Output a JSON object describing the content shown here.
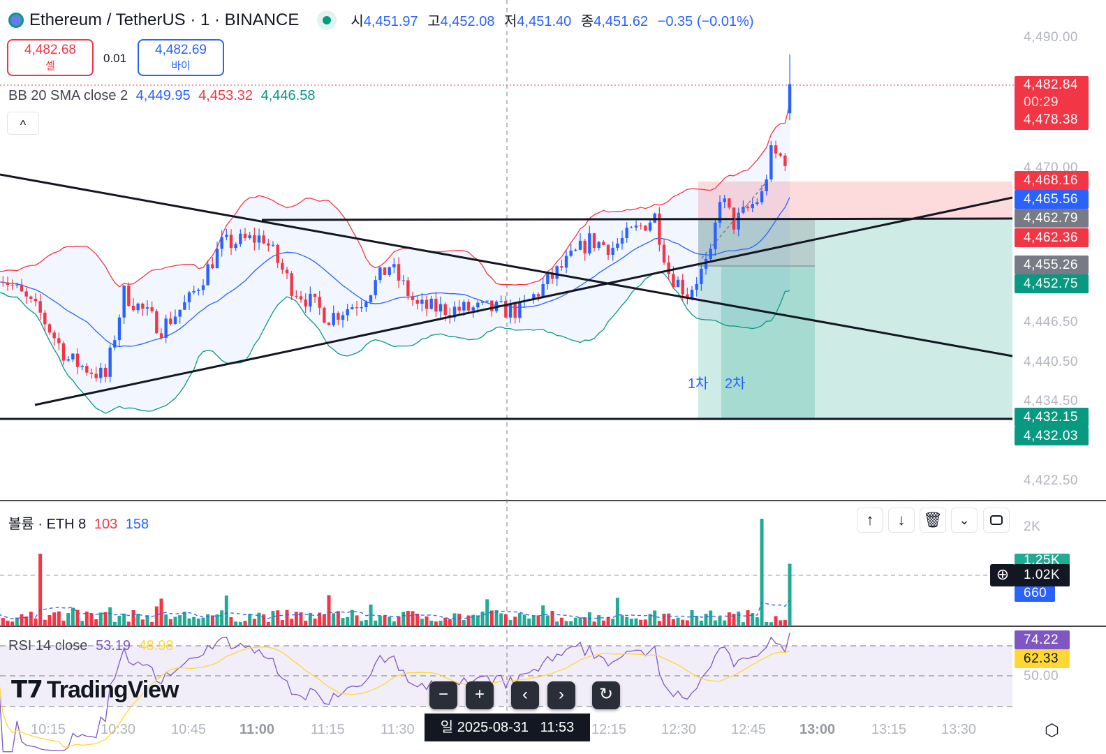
{
  "header": {
    "symbol": "Ethereum / TetherUS · 1 · BINANCE",
    "ohlc": [
      {
        "k": "시",
        "v": "4,451.97"
      },
      {
        "k": "고",
        "v": "4,452.08"
      },
      {
        "k": "저",
        "v": "4,451.40"
      },
      {
        "k": "종",
        "v": "4,451.62"
      }
    ],
    "change": "−0.35 (−0.01%)"
  },
  "trade": {
    "sell_price": "4,482.68",
    "sell_label": "셀",
    "spread": "0.01",
    "buy_price": "4,482.69",
    "buy_label": "바이"
  },
  "bb": {
    "label": "BB 20 SMA close 2",
    "basis": "4,449.95",
    "upper": "4,453.32",
    "lower": "4,446.58"
  },
  "collapse_label": "^",
  "drawing_labels": {
    "first": "1차",
    "second": "2차"
  },
  "price_axis": [
    "4,490.00",
    "4,470.00",
    "4,446.50",
    "4,440.50",
    "4,434.50",
    "4,422.50"
  ],
  "price_tags": [
    {
      "v": "4,482.84",
      "sub": "00:29",
      "v2": "4,478.38",
      "color": "#f23645"
    },
    {
      "v": "4,468.16",
      "color": "#f23645"
    },
    {
      "v": "4,465.56",
      "color": "#2962ff"
    },
    {
      "v": "4,462.79",
      "color": "#787b86"
    },
    {
      "v": "4,462.36",
      "color": "#f23645"
    },
    {
      "v": "4,455.26",
      "color": "#787b86"
    },
    {
      "v": "4,452.75",
      "color": "#089981"
    },
    {
      "v": "4,432.15",
      "color": "#089981"
    },
    {
      "v": "4,432.03",
      "color": "#089981"
    }
  ],
  "volume": {
    "label": "볼륨 · ETH 8",
    "v1": "103",
    "v2": "158",
    "axis": "2K",
    "tag_hidden": "1.25K",
    "tag_cross": "1.02K",
    "tag_ma": "660"
  },
  "rsi": {
    "label": "RSI 14 close",
    "v1": "53.19",
    "v2": "48.98",
    "tag1": "74.22",
    "tag2": "62.33",
    "axis": "50.00"
  },
  "pane_buttons": [
    "move-up",
    "move-down",
    "delete",
    "collapse",
    "maximize"
  ],
  "nav_buttons": {
    "zoom_out": "−",
    "zoom_in": "+",
    "left": "‹",
    "right": "›",
    "reset": "↻"
  },
  "brand": "TradingView",
  "time_axis": [
    "10:15",
    "10:30",
    "10:45",
    "11:00",
    "11:15",
    "11:30",
    "12:15",
    "12:30",
    "12:45",
    "13:00",
    "13:15",
    "13:30"
  ],
  "crosshair_time": "일 2025-08-31   11:53",
  "colors": {
    "up": "#2962ff",
    "down": "#f23645",
    "vol_up": "#22ab94",
    "vol_down": "#f23645",
    "bb_upper": "#f23645",
    "bb_lower": "#089981",
    "bb_basis": "#2962ff",
    "rsi": "#7e57c2",
    "rsi_ma": "#fdd835"
  },
  "price_path": [
    [
      4,
      4454.2
    ],
    [
      13,
      4447.8
    ],
    [
      19,
      4440.9
    ],
    [
      27,
      4438.2
    ],
    [
      31,
      4451
    ],
    [
      39,
      4445.7
    ],
    [
      45,
      4449.9
    ],
    [
      52,
      4458.4
    ],
    [
      61,
      4459.5
    ],
    [
      67,
      4452
    ],
    [
      75,
      4447.3
    ],
    [
      82,
      4449.9
    ],
    [
      88,
      4455.2
    ],
    [
      94,
      4448.9
    ],
    [
      101,
      4448.5
    ],
    [
      109,
      4448.6
    ],
    [
      116,
      4448.3
    ],
    [
      124,
      4454.2
    ],
    [
      131,
      4459
    ],
    [
      136,
      4458
    ],
    [
      145,
      4462.7
    ],
    [
      148,
      4454.2
    ],
    [
      152,
      4451
    ],
    [
      157,
      4456.3
    ],
    [
      159,
      4465.9
    ],
    [
      162,
      4461.6
    ],
    [
      168,
      4465.9
    ],
    [
      170,
      4472.2
    ],
    [
      173,
      4471.5
    ],
    [
      174,
      4482.84
    ]
  ]
}
